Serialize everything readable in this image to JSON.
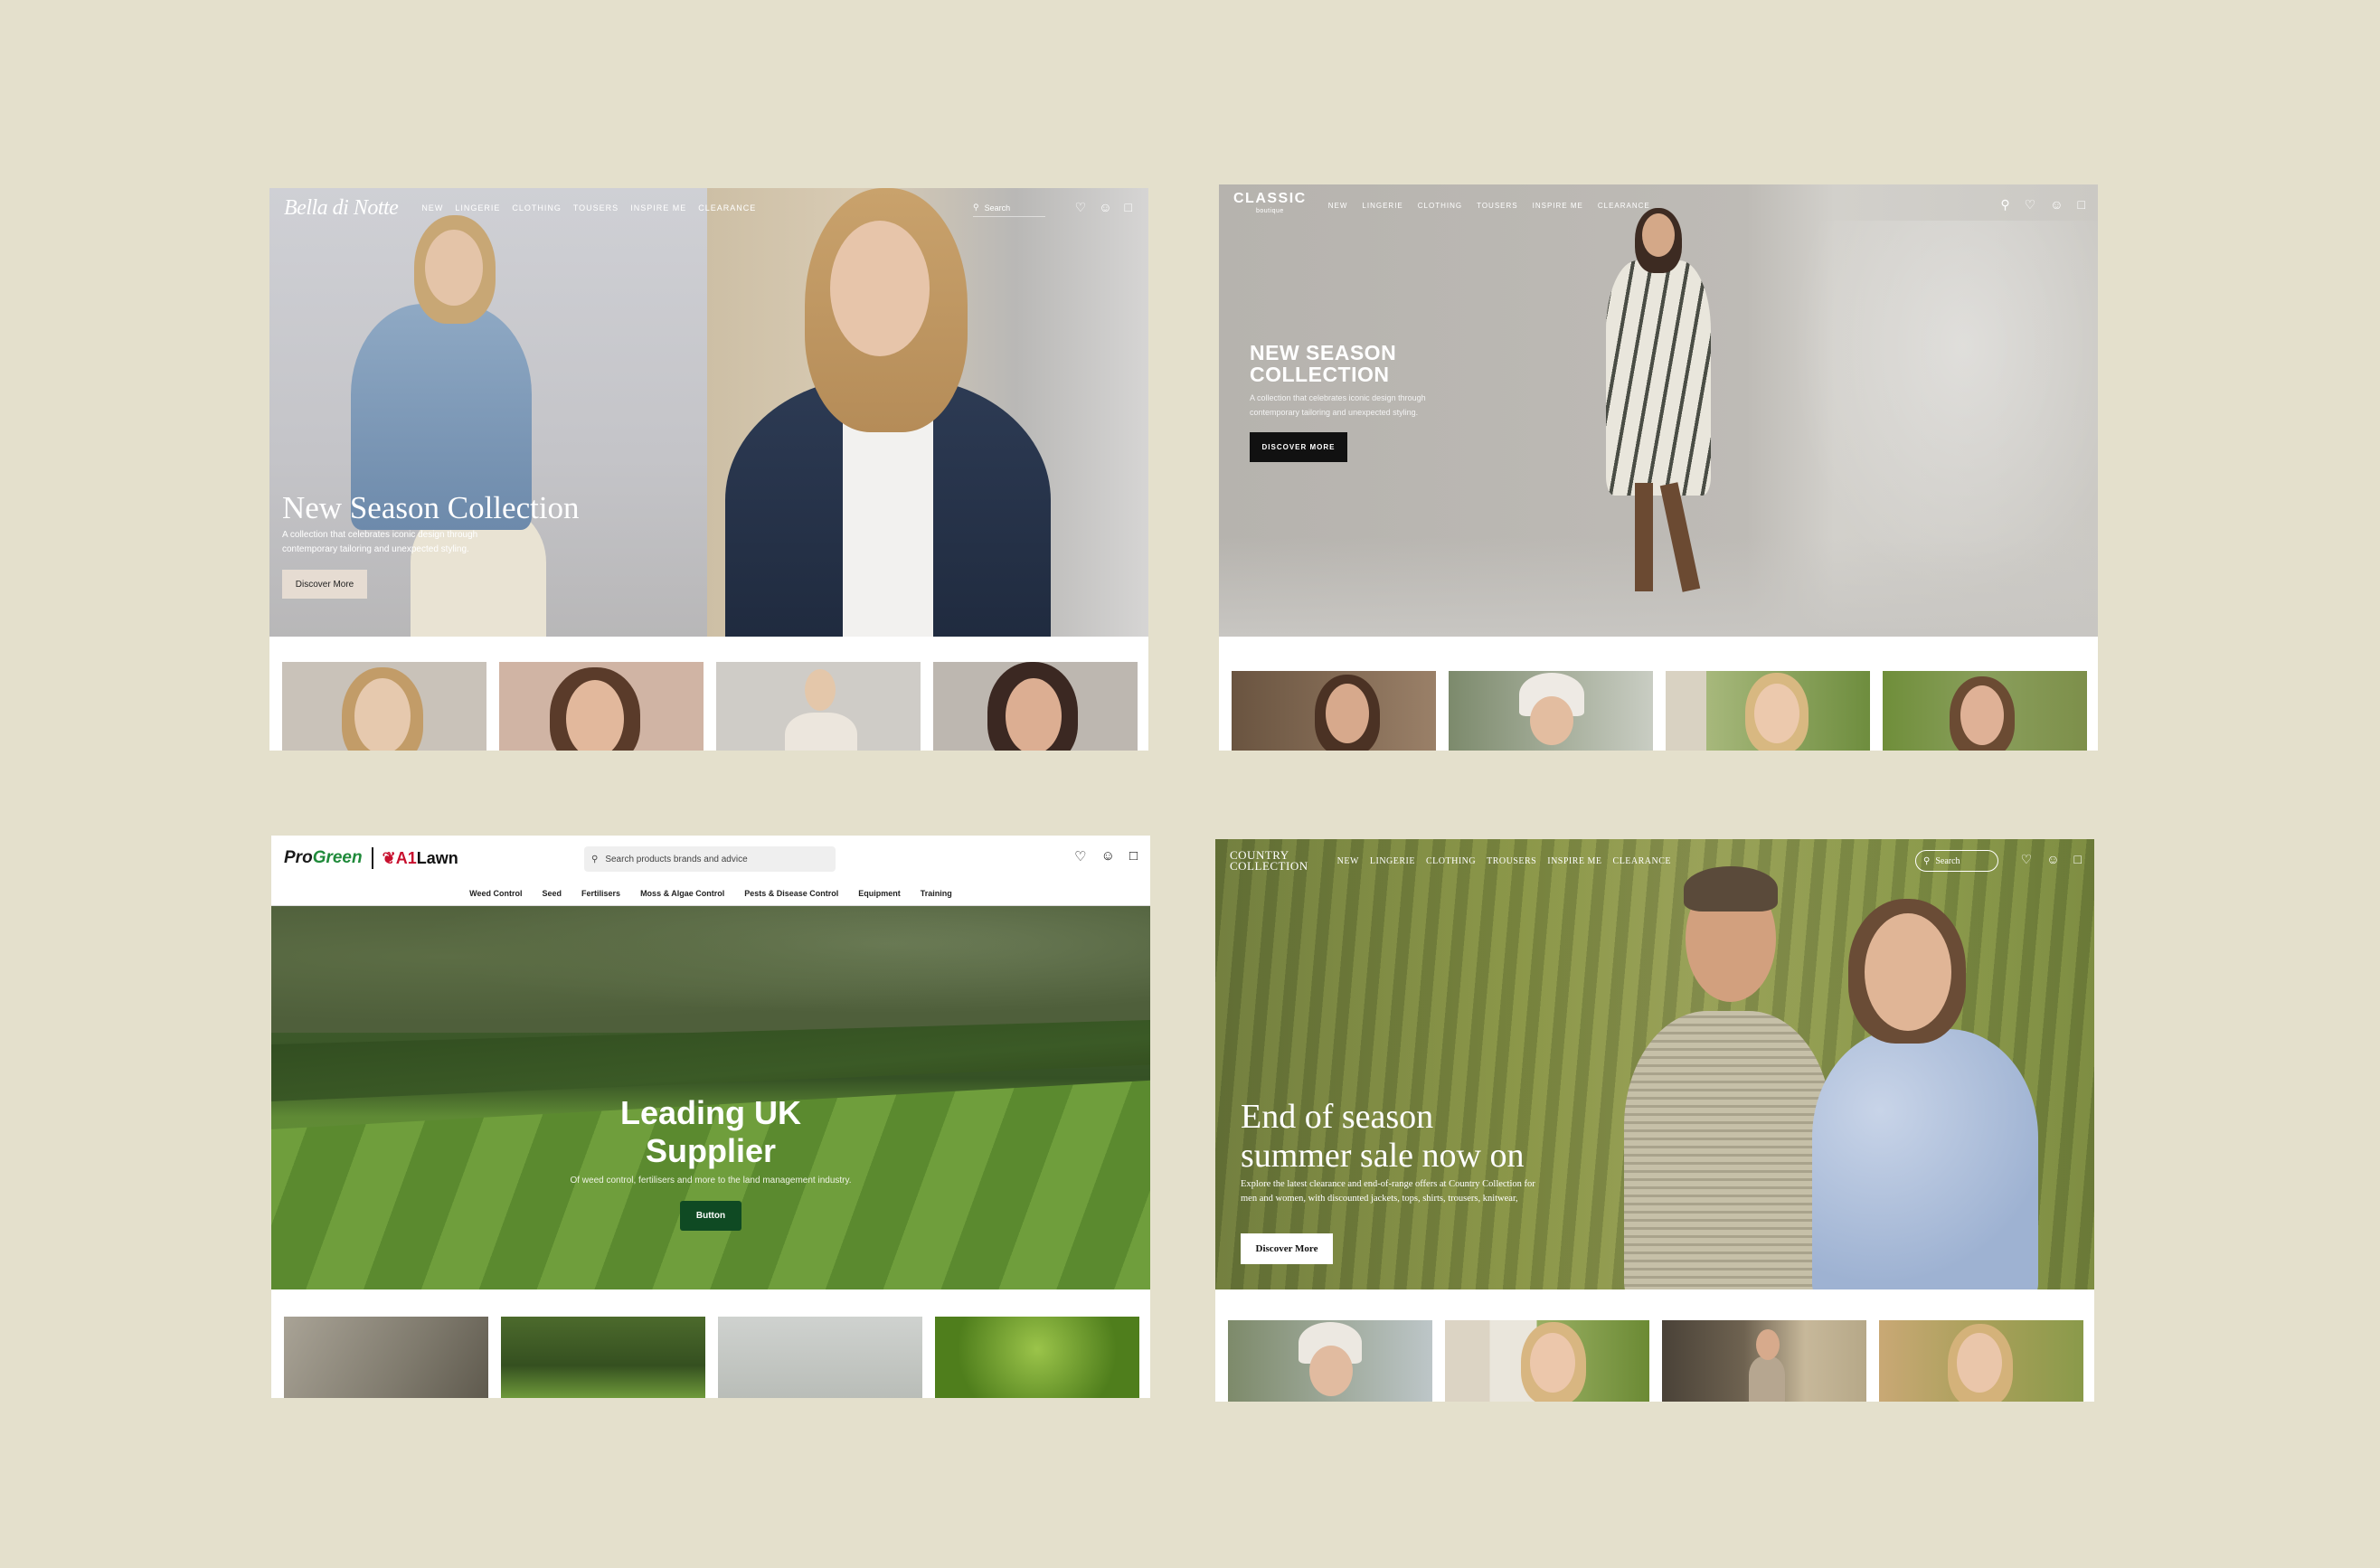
{
  "bella": {
    "logo": "Bella di Notte",
    "menu": [
      "NEW",
      "LINGERIE",
      "CLOTHING",
      "TOUSERS",
      "INSPIRE ME",
      "CLEARANCE"
    ],
    "search_placeholder": "Search",
    "hero_title": "New Season Collection",
    "hero_desc": "A collection that celebrates iconic design through contemporary tailoring and unexpected styling.",
    "button": "Discover More"
  },
  "classic": {
    "logo": "CLASSIC",
    "logo_sub": "boutique",
    "menu": [
      "NEW",
      "LINGERIE",
      "CLOTHING",
      "TOUSERS",
      "INSPIRE ME",
      "CLEARANCE"
    ],
    "hero_title_line1": "NEW SEASON",
    "hero_title_line2": "COLLECTION",
    "hero_desc": "A collection that celebrates iconic design through contemporary tailoring and unexpected styling.",
    "button": "DISCOVER MORE"
  },
  "progreen": {
    "logo_a1": "Pro",
    "logo_a2": "Green",
    "logo_b1": "A1",
    "logo_b2": "Lawn",
    "search_placeholder": "Search products brands and advice",
    "subnav": [
      "Weed Control",
      "Seed",
      "Fertilisers",
      "Moss & Algae Control",
      "Pests & Disease Control",
      "Equipment",
      "Training"
    ],
    "hero_title_line1": "Leading UK",
    "hero_title_line2": "Supplier",
    "hero_desc": "Of weed control, fertilisers and more to the land management industry.",
    "button": "Button"
  },
  "country": {
    "logo_line1": "COUNTRY",
    "logo_line2": "COLLECTION",
    "menu": [
      "NEW",
      "LINGERIE",
      "CLOTHING",
      "TROUSERS",
      "INSPIRE ME",
      "CLEARANCE"
    ],
    "search_placeholder": "Search",
    "hero_title_line1": "End of season",
    "hero_title_line2": "summer sale now on",
    "hero_desc": "Explore the latest clearance and end-of-range offers at Country Collection for men and women, with discounted jackets, tops, shirts, trousers, knitwear,",
    "button": "Discover More"
  },
  "colors": {
    "background": "#e4e0cc",
    "progreen_green": "#1f8a3a",
    "progreen_button": "#0f4a23",
    "a1lawn_red": "#c8102e"
  },
  "icons": [
    "search-icon",
    "heart-icon",
    "user-icon",
    "bag-icon"
  ]
}
